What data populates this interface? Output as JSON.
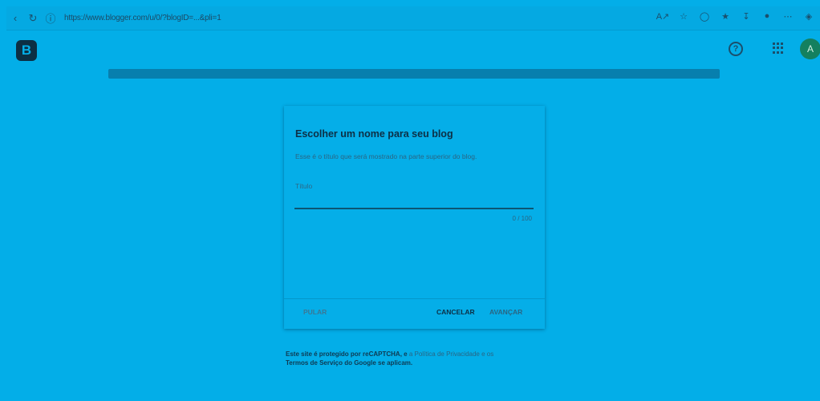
{
  "browser": {
    "url": "https://www.blogger.com/u/0/?blogID=...&pli=1",
    "icons": [
      "back-icon",
      "refresh-icon",
      "site-info-icon",
      "read-aloud-icon",
      "favorite-icon",
      "extensions-icon",
      "favorites-bar-icon",
      "downloads-icon",
      "profile-icon",
      "more-icon",
      "edge-copilot-icon"
    ]
  },
  "header": {
    "logo_letter": "B",
    "help_glyph": "?",
    "avatar_initial": "A"
  },
  "dialog": {
    "title": "Escolher um nome para seu blog",
    "description": "Esse é o título que será mostrado na parte superior do blog.",
    "field_label": "Título",
    "input_value": "",
    "counter": "0 / 100",
    "skip_label": "PULAR",
    "cancel_label": "CANCELAR",
    "next_label": "AVANÇAR"
  },
  "footer": {
    "line1_bold": "Este site é protegido por reCAPTCHA, e",
    "line1_light": " a Política de Privacidade e os",
    "line2": "Termos de Serviço do Google se aplicam."
  },
  "colors": {
    "background": "#03aee8",
    "logo": "#0c2f44",
    "avatar": "#14805f",
    "input_underline": "#0b5574"
  }
}
